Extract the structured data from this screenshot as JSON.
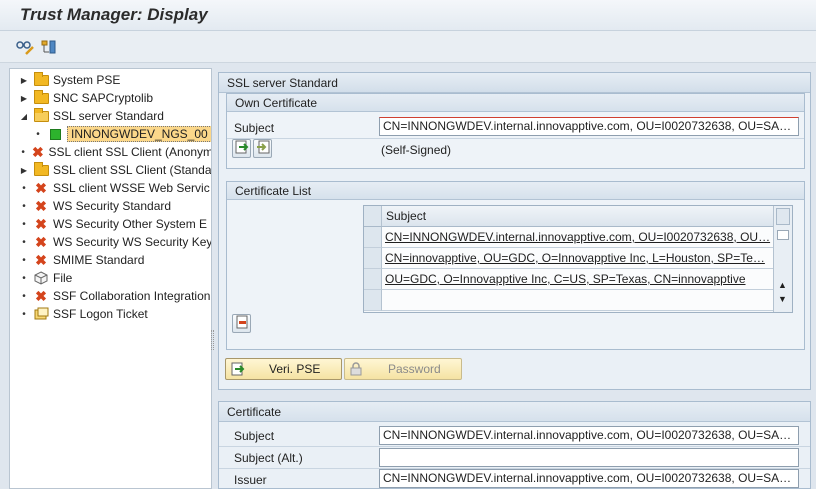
{
  "window": {
    "title": "Trust Manager: Display"
  },
  "toolbar": {
    "buttons": [
      {
        "icon": "glasses-pencil-icon"
      },
      {
        "icon": "tree-overview-icon"
      }
    ]
  },
  "tree": {
    "items": [
      {
        "label": "System PSE",
        "icon": "folder-icon",
        "expander": "collapsed"
      },
      {
        "label": "SNC SAPCryptolib",
        "icon": "folder-icon",
        "expander": "collapsed"
      },
      {
        "label": "SSL server Standard",
        "icon": "folder-open-icon",
        "expander": "expanded"
      },
      {
        "label": "INNONGWDEV_NGS_00",
        "icon": "green-square-icon",
        "expander": "leaf",
        "selected": true
      },
      {
        "label": "SSL client SSL Client (Anonym",
        "icon": "red-x-icon",
        "expander": "leaf"
      },
      {
        "label": "SSL client SSL Client (Standa",
        "icon": "folder-icon",
        "expander": "collapsed"
      },
      {
        "label": "SSL client WSSE Web Servic",
        "icon": "red-x-icon",
        "expander": "leaf"
      },
      {
        "label": "WS Security Standard",
        "icon": "red-x-icon",
        "expander": "leaf"
      },
      {
        "label": "WS Security Other System E",
        "icon": "red-x-icon",
        "expander": "leaf"
      },
      {
        "label": "WS Security WS Security Key",
        "icon": "red-x-icon",
        "expander": "leaf"
      },
      {
        "label": "SMIME Standard",
        "icon": "red-x-icon",
        "expander": "leaf"
      },
      {
        "label": "File",
        "icon": "cube-icon",
        "expander": "leaf"
      },
      {
        "label": "SSF Collaboration Integration",
        "icon": "red-x-icon",
        "expander": "leaf"
      },
      {
        "label": "SSF Logon Ticket",
        "icon": "ticket-icon",
        "expander": "leaf"
      }
    ]
  },
  "main": {
    "section_title": "SSL server Standard",
    "own_certificate": {
      "title": "Own Certificate",
      "subject_label": "Subject",
      "subject_value": "CN=INNONGWDEV.internal.innovapptive.com, OU=I0020732638, OU=SA…",
      "self_signed": "(Self-Signed)"
    },
    "certificate_list": {
      "title": "Certificate List",
      "column": "Subject",
      "rows": [
        "CN=INNONGWDEV.internal.innovapptive.com, OU=I0020732638, OU…",
        "CN=innovapptive, OU=GDC, O=Innovapptive Inc, L=Houston, SP=Te…",
        "OU=GDC, O=Innovapptive Inc, C=US, SP=Texas, CN=innovapptive"
      ]
    },
    "buttons": {
      "veri_pse": "Veri. PSE",
      "password": "Password"
    },
    "certificate": {
      "title": "Certificate",
      "subject_label": "Subject",
      "subject_value": "CN=INNONGWDEV.internal.innovapptive.com, OU=I0020732638, OU=SA…",
      "subject_alt_label": "Subject (Alt.)",
      "subject_alt_value": "",
      "issuer_label": "Issuer",
      "issuer_value": "CN=INNONGWDEV.internal.innovapptive.com, OU=I0020732638, OU=SA…"
    }
  },
  "colors": {
    "accent": "#f5e3a3",
    "selection": "#fbd78a",
    "panel": "#eaf0f6",
    "error": "#d4441c",
    "ok": "#2db32d"
  }
}
